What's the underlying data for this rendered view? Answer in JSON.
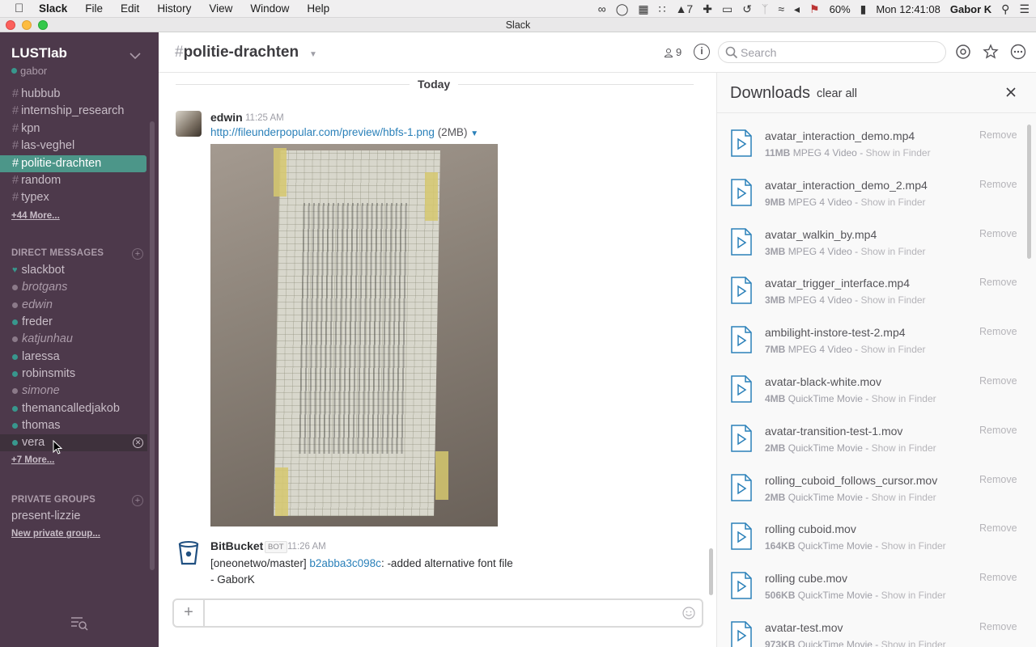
{
  "menubar": {
    "app_name": "Slack",
    "items": [
      "File",
      "Edit",
      "History",
      "View",
      "Window",
      "Help"
    ],
    "status": {
      "notif_count": "7",
      "battery": "60%",
      "clock": "Mon 12:41:08",
      "user": "Gabor K"
    }
  },
  "window": {
    "title": "Slack"
  },
  "sidebar": {
    "team_name": "LUSTlab",
    "user_name": "gabor",
    "channels": [
      "hubbub",
      "internship_research",
      "kpn",
      "las-veghel",
      "politie-drachten",
      "random",
      "typex"
    ],
    "active_channel": "politie-drachten",
    "channels_more": "+44 More...",
    "dm_header": "DIRECT MESSAGES",
    "direct_messages": [
      {
        "name": "slackbot",
        "status": "heart"
      },
      {
        "name": "brotgans",
        "status": "away"
      },
      {
        "name": "edwin",
        "status": "away"
      },
      {
        "name": "freder",
        "status": "online"
      },
      {
        "name": "katjunhau",
        "status": "away"
      },
      {
        "name": "laressa",
        "status": "online"
      },
      {
        "name": "robinsmits",
        "status": "online"
      },
      {
        "name": "simone",
        "status": "away"
      },
      {
        "name": "themancalledjakob",
        "status": "online"
      },
      {
        "name": "thomas",
        "status": "online"
      },
      {
        "name": "vera",
        "status": "online"
      }
    ],
    "dm_more": "+7 More...",
    "pg_header": "PRIVATE GROUPS",
    "private_groups": [
      "present-lizzie"
    ],
    "new_group": "New private group..."
  },
  "header": {
    "channel": "politie-drachten",
    "member_count": "9",
    "search_placeholder": "Search"
  },
  "messages": {
    "day_divider": "Today",
    "first": {
      "author": "edwin",
      "time": "11:25 AM",
      "link": "http://fileunderpopular.com/preview/hbfs-1.png",
      "size": "(2MB)"
    },
    "second": {
      "author": "BitBucket",
      "badge": "BOT",
      "time": "11:26 AM",
      "prefix": "[oneonetwo/master]",
      "commit": "b2abba3c098c",
      "text": ": -added alternative font file",
      "line2": "- GaborK"
    }
  },
  "composer": {
    "placeholder": ""
  },
  "downloads": {
    "title": "Downloads",
    "clear_label": "clear all",
    "remove_label": "Remove",
    "finder_label": "Show in Finder",
    "items": [
      {
        "name": "avatar_interaction_demo.mp4",
        "size": "11MB",
        "type": "MPEG 4 Video"
      },
      {
        "name": "avatar_interaction_demo_2.mp4",
        "size": "9MB",
        "type": "MPEG 4 Video"
      },
      {
        "name": "avatar_walkin_by.mp4",
        "size": "3MB",
        "type": "MPEG 4 Video"
      },
      {
        "name": "avatar_trigger_interface.mp4",
        "size": "3MB",
        "type": "MPEG 4 Video"
      },
      {
        "name": "ambilight-instore-test-2.mp4",
        "size": "7MB",
        "type": "MPEG 4 Video"
      },
      {
        "name": "avatar-black-white.mov",
        "size": "4MB",
        "type": "QuickTime Movie"
      },
      {
        "name": "avatar-transition-test-1.mov",
        "size": "2MB",
        "type": "QuickTime Movie"
      },
      {
        "name": "rolling_cuboid_follows_cursor.mov",
        "size": "2MB",
        "type": "QuickTime Movie"
      },
      {
        "name": "rolling cuboid.mov",
        "size": "164KB",
        "type": "QuickTime Movie"
      },
      {
        "name": "rolling cube.mov",
        "size": "506KB",
        "type": "QuickTime Movie"
      },
      {
        "name": "avatar-test.mov",
        "size": "973KB",
        "type": "QuickTime Movie"
      }
    ]
  },
  "colors": {
    "sidebar_bg": "#4d394b",
    "active_channel": "#4c9689",
    "link": "#2a80b9"
  }
}
